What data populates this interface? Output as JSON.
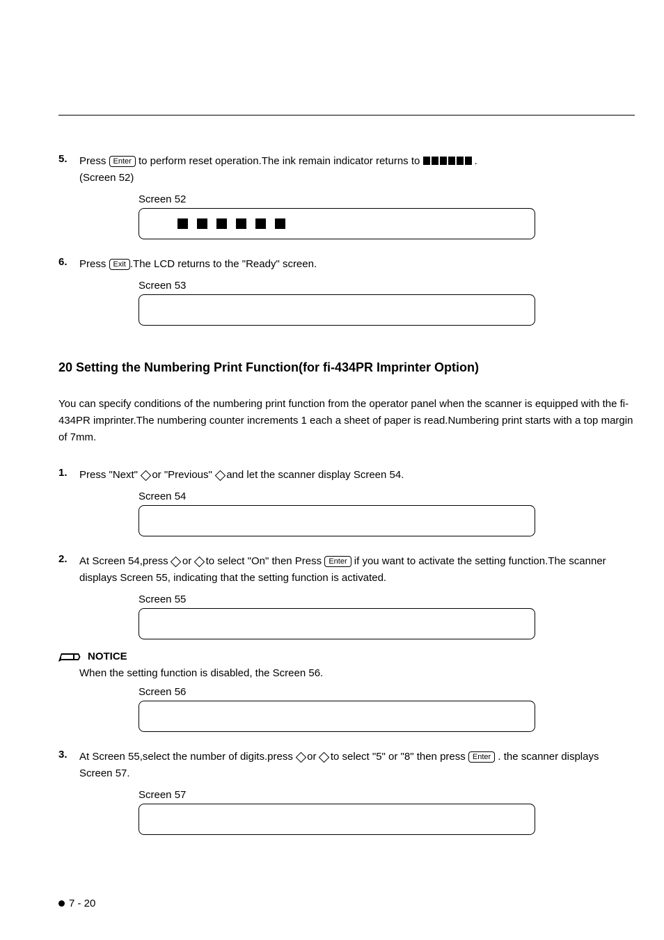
{
  "step5": {
    "num": "5.",
    "text_a": "Press ",
    "key": "Enter",
    "text_b": " to perform reset operation.The ink remain indicator returns to ",
    "text_c": " .",
    "paren": "(Screen 52)"
  },
  "screen52_label": "Screen 52",
  "step6": {
    "num": "6.",
    "text_a": "Press ",
    "key": "Exit",
    "text_b": ".The LCD returns to the \"Ready\" screen."
  },
  "screen53_label": "Screen 53",
  "section_heading": "20   Setting the Numbering Print Function(for fi-434PR Imprinter Option)",
  "intro": "You can specify conditions of the numbering print function from the operator panel when the scanner is equipped with the fi-434PR imprinter.The numbering counter increments 1 each a sheet of paper is read.Numbering print starts with a top margin of 7mm.",
  "step1": {
    "num": "1.",
    "text_a": "Press \"Next\" ",
    "text_b": " or \"Previous\" ",
    "text_c": " and let the scanner display Screen 54."
  },
  "screen54_label": "Screen 54",
  "step2": {
    "num": "2.",
    "text_a": "At Screen 54,press ",
    "text_b": " or ",
    "text_c": " to select \"On\" then Press ",
    "key": "Enter",
    "text_d": " if you want to activate the setting function.The scanner displays Screen 55, indicating that the setting function is activated."
  },
  "screen55_label": "Screen 55",
  "notice_label": "NOTICE",
  "notice_text": "When the setting function is disabled, the Screen 56.",
  "screen56_label": "Screen 56",
  "step3": {
    "num": "3.",
    "text_a": "At Screen 55,select the number of digits.press ",
    "text_b": " or ",
    "text_c": " to select \"5\" or \"8\" then press ",
    "key": "Enter",
    "text_d": " . the scanner displays Screen 57."
  },
  "screen57_label": "Screen 57",
  "page_num": "7 - 20"
}
